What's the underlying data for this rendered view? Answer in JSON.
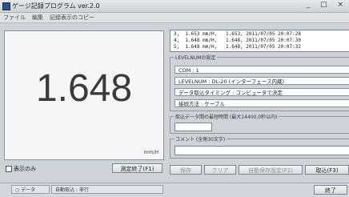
{
  "window": {
    "title": "ゲージ記録プログラム ver.2.0",
    "controls": "_ □ ×"
  },
  "menu": {
    "items": [
      "ファイル",
      "編集",
      "記録表示のコピー"
    ]
  },
  "display": {
    "value": "1.648",
    "unit": "mm/H"
  },
  "left_controls": {
    "show_only_label": "表示のみ",
    "show_only_checked": false,
    "end_measure_label": "測定終了(F1)"
  },
  "log": {
    "lines": [
      "3,  1.653 mm/H,   1.653, 2011/07/05 20:07:28",
      "4,  1.648 mm/H,   1.648, 2011/07/05 20:07:30",
      "5,  1.648 mm/H,   1.648, 2011/07/05 20:07:32"
    ]
  },
  "level_settings": {
    "legend": "LEVELNUMの設定",
    "com": "COM : 1",
    "levelnum": "LEVELNUM : DL-20 (インターフェース内蔵)",
    "timing": "データ取込タイミング : コンピュータで決定",
    "connection": "接続方法 : ケーブル"
  },
  "interval": {
    "legend": "取込データ間の最短時間 (最大14400,0秒以内)",
    "value": ""
  },
  "comment": {
    "legend": "コメント (全角30文字)",
    "value": ""
  },
  "buttons": {
    "save": "保存",
    "clear": "クリア",
    "auto_save": "自動保存設定(F2)",
    "capture": "取込(F3)"
  },
  "statusbar": {
    "mode": "データ",
    "auto_status": "自動取込 : 非行",
    "exit": "終了"
  }
}
